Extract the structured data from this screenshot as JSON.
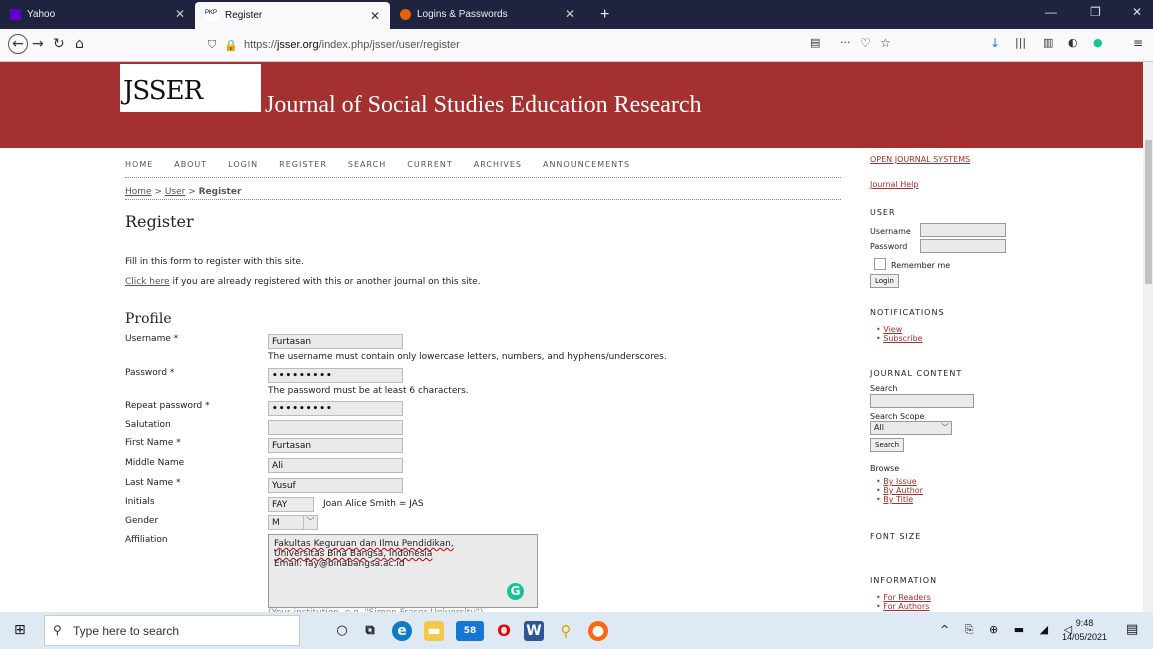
{
  "browser": {
    "tabs": [
      {
        "label": "Yahoo"
      },
      {
        "label": "Register"
      },
      {
        "label": "Logins & Passwords"
      }
    ],
    "url_prefix": "https://",
    "url_domain": "jsser.org",
    "url_path": "/index.php/jsser/user/register"
  },
  "site": {
    "logo_text": "JSSER",
    "journal_title": "Journal of Social Studies Education Research",
    "menu": [
      "HOME",
      "ABOUT",
      "LOGIN",
      "REGISTER",
      "SEARCH",
      "CURRENT",
      "ARCHIVES",
      "ANNOUNCEMENTS"
    ],
    "breadcrumb": {
      "home": "Home",
      "user": "User",
      "current": "Register"
    },
    "page_title": "Register",
    "intro": "Fill in this form to register with this site.",
    "click_here": "Click here",
    "already": " if you are already registered with this or another journal on this site.",
    "profile_heading": "Profile"
  },
  "form": {
    "username_label": "Username *",
    "username_value": "Furtasan",
    "username_hint": "The username must contain only lowercase letters, numbers, and hyphens/underscores.",
    "password_label": "Password *",
    "password_value": "•••••••••",
    "password_hint": "The password must be at least 6 characters.",
    "repeat_label": "Repeat password *",
    "repeat_value": "•••••••••",
    "salutation_label": "Salutation",
    "salutation_value": "",
    "first_label": "First Name *",
    "first_value": "Furtasan",
    "middle_label": "Middle Name",
    "middle_value": "Ali",
    "last_label": "Last Name *",
    "last_value": "Yusuf",
    "initials_label": "Initials",
    "initials_value": "FAY",
    "initials_hint": "Joan Alice Smith = JAS",
    "gender_label": "Gender",
    "gender_value": "M",
    "affiliation_label": "Affiliation",
    "affiliation_line1": "Fakultas Keguruan dan Ilmu Pendidikan,",
    "affiliation_line2": "Universitas Bina Bangsa, Indonesia",
    "affiliation_line3": "Email: fay@binabangsa.ac.id",
    "affiliation_hint": "(Your institution, e.g. \"Simon Fraser University\")"
  },
  "sidebar": {
    "ojs_link": "OPEN JOURNAL SYSTEMS",
    "help_link": "Journal Help",
    "user_head": "USER",
    "username_label": "Username",
    "password_label": "Password",
    "remember": "Remember me",
    "login_btn": "Login",
    "notif_head": "NOTIFICATIONS",
    "view": "View",
    "subscribe": "Subscribe",
    "content_head": "JOURNAL CONTENT",
    "search_label": "Search",
    "scope_label": "Search Scope",
    "scope_value": "All",
    "search_btn": "Search",
    "browse_label": "Browse",
    "by_issue": "By Issue",
    "by_author": "By Author",
    "by_title": "By Title",
    "font_head": "FONT SIZE",
    "info_head": "INFORMATION",
    "for_readers": "For Readers",
    "for_authors": "For Authors"
  },
  "taskbar": {
    "search_placeholder": "Type here to search",
    "badge": "58",
    "time": "9:48",
    "date": "14/05/2021"
  },
  "colors": {
    "header": "#a53030",
    "tabbar": "#202340",
    "link": "#a53030"
  }
}
